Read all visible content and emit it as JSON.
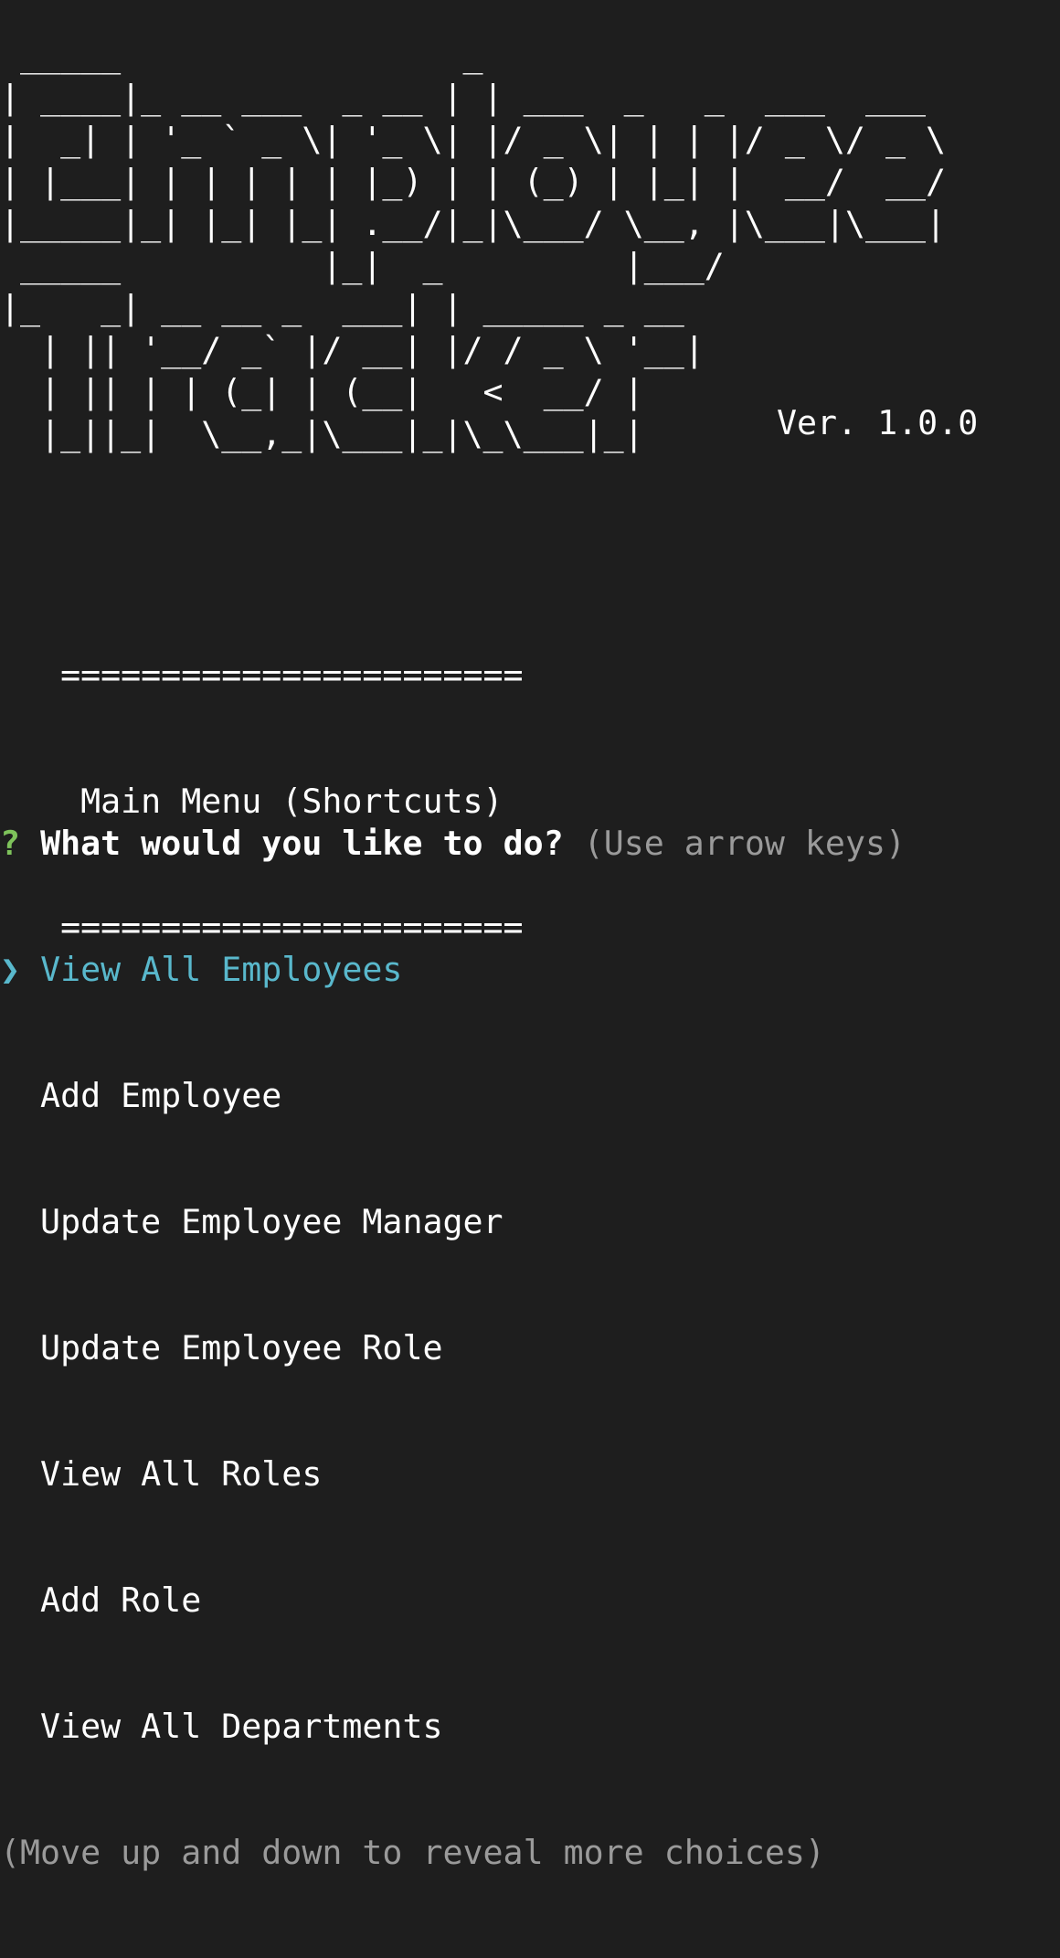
{
  "banner": {
    "lines": [
      " _____                 _",
      "| ____|_ __ ___  _ __ | | ___  _   _  ___  ___",
      "|  _| | '_ ` _ \\| '_ \\| |/ _ \\| | | |/ _ \\/ _ \\",
      "| |___| | | | | | |_) | | (_) | |_| |  __/  __/",
      "|_____|_| |_| |_| .__/|_|\\___/ \\__, |\\___|\\___|",
      " _____          |_|  _         |___/",
      "|_   _| __ __ _  ___| | _____ _ __",
      "  | || '__/ _` |/ __| |/ / _ \\ '__|",
      "  | || | | (_| | (__|   <  __/ |",
      "  |_||_|  \\__,_|\\___|_|\\_\\___|_|"
    ],
    "version": "Ver. 1.0.0"
  },
  "menu": {
    "rule_top": "   =======================",
    "title": "    Main Menu (Shortcuts)",
    "rule_bottom": "   ======================="
  },
  "prompt": {
    "qmark": "?",
    "question": "What would you like to do?",
    "hint": "(Use arrow keys)",
    "pointer": "❯",
    "selected": "View All Employees",
    "choices": [
      "Add Employee",
      "Update Employee Manager",
      "Update Employee Role",
      "View All Roles",
      "Add Role",
      "View All Departments"
    ],
    "footer": "(Move up and down to reveal more choices)"
  },
  "colors": {
    "background": "#1e1e1e",
    "qmark": "#7ec25b",
    "selected": "#59b8cc",
    "hint": "#9a9a9a"
  }
}
